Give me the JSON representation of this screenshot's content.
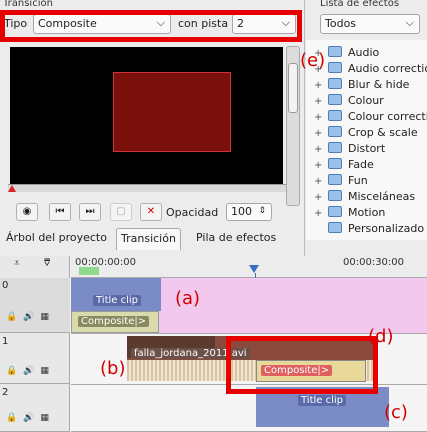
{
  "transition_panel": {
    "title": "Transición",
    "type_label": "Tipo",
    "type_value": "Composite",
    "track_label": "con pista",
    "track_value": "2",
    "opacity_label": "Opacidad",
    "opacity_value": "100"
  },
  "effects_panel": {
    "title": "Lista de efectos",
    "filter_value": "Todos",
    "items": [
      "Audio",
      "Audio correction",
      "Blur & hide",
      "Colour",
      "Colour correction",
      "Crop & scale",
      "Distort",
      "Fade",
      "Fun",
      "Misceláneas",
      "Motion",
      "Personalizado"
    ]
  },
  "tabs": [
    "Árbol del proyecto",
    "Transición",
    "Pila de efectos"
  ],
  "timeline": {
    "time_start": "00:00:00:00",
    "time_end": "00:00:30:00",
    "tracks": [
      "0",
      "1",
      "2"
    ],
    "clips": {
      "title_clip_1": "Title clip",
      "composite_1": "Composite|>",
      "video_clip": "falla_jordana_2011.avi",
      "composite_2": "Composite|>",
      "title_clip_2": "Title clip"
    }
  },
  "annotations": {
    "a": "(a)",
    "b": "(b)",
    "c": "(c)",
    "d": "(d)",
    "e": "(e)"
  },
  "colors": {
    "highlight": "#e60000",
    "composite_track0": "#d8dbab",
    "composite_track1_selected": "#e8d89a",
    "title_clip": "#7b8bc6",
    "track0_bg": "#f2c8ee",
    "preview_rect": "#7a0f0b"
  }
}
